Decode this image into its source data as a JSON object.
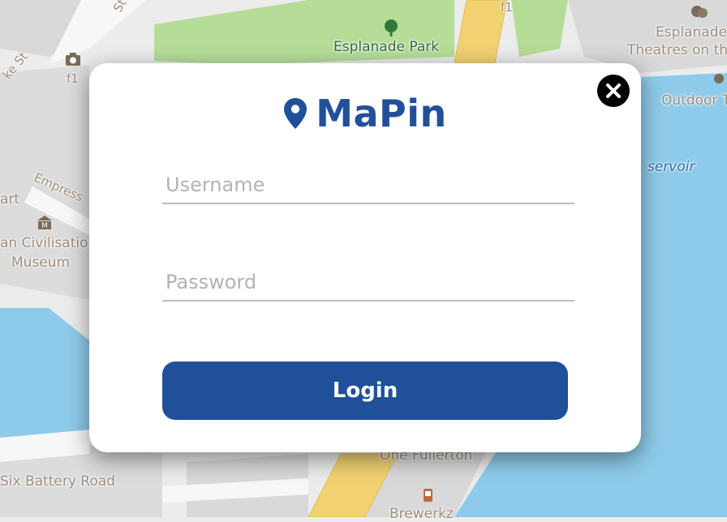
{
  "map": {
    "labels": {
      "esplanade_park": "Esplanade Park",
      "esplanade_theatres_line1": "Esplanade",
      "esplanade_theatres_line2": "Theatres on th",
      "outdoor": "Outdoor T",
      "reservoir": "servoir",
      "empress": "Empress",
      "art": "art",
      "civilisation_line1": "an Civilisatio",
      "civilisation_line2": "Museum",
      "six_battery_road": "Six Battery Road",
      "one_fullerton": "One Fullerton",
      "brewerkz": "Brewerkz",
      "f1_left": "f1",
      "f1_top": "f1",
      "street_top": "St",
      "street_left": "ke St"
    }
  },
  "login": {
    "app_name": "MaPin",
    "username_placeholder": "Username",
    "password_placeholder": "Password",
    "login_label": "Login"
  },
  "colors": {
    "brand": "#21509a",
    "water": "#8ecbea",
    "park": "#b5dd98",
    "road_major": "#f1d172"
  },
  "icons": {
    "logo": "map-pin-icon",
    "close": "close-icon",
    "camera": "camera-icon",
    "museum": "museum-icon",
    "theatre": "theatre-masks-icon",
    "tree": "tree-icon",
    "beer": "beer-icon"
  }
}
